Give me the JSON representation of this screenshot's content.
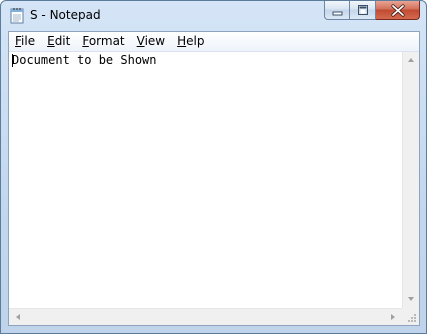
{
  "window": {
    "title": "S - Notepad",
    "icon": "notepad-icon"
  },
  "caption_buttons": {
    "minimize": "minimize-icon",
    "maximize": "maximize-icon",
    "close": "close-icon"
  },
  "menu": {
    "items": [
      {
        "mnemonic": "F",
        "rest": "ile"
      },
      {
        "mnemonic": "E",
        "rest": "dit"
      },
      {
        "mnemonic": "F",
        "rest": "ormat",
        "prefix": ""
      },
      {
        "mnemonic": "V",
        "rest": "iew"
      },
      {
        "mnemonic": "H",
        "rest": "elp"
      }
    ]
  },
  "editor": {
    "content": "Document to be Shown"
  },
  "colors": {
    "title_bar": "#c3d7ee",
    "close_button": "#c24a32",
    "editor_background": "#ffffff"
  }
}
